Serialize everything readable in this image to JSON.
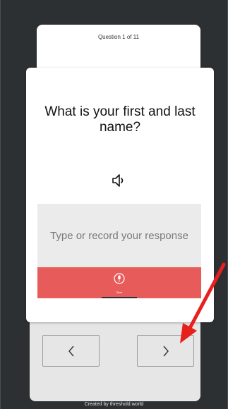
{
  "progress": {
    "label": "Question 1 of 11",
    "current": 1,
    "total": 11
  },
  "question": {
    "text": "What is your first and last name?",
    "audio_icon": "speaker-icon"
  },
  "response": {
    "placeholder": "Type or record your response",
    "record_icon": "microphone-icon",
    "start_label": "Start"
  },
  "navigation": {
    "prev_icon": "chevron-left-icon",
    "next_icon": "chevron-right-icon"
  },
  "footer": {
    "credit": "Created by threshold.world"
  },
  "colors": {
    "background": "#2d3033",
    "record_bar": "#e85b5b",
    "progress_track": "#c9ddc9",
    "progress_fill": "#2f3338",
    "annotation_arrow": "#e8201d"
  }
}
